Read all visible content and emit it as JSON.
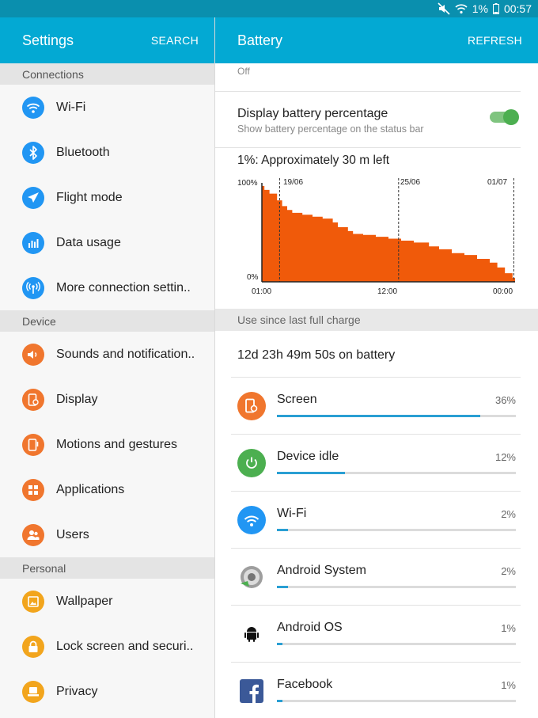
{
  "status_bar": {
    "battery_percent": "1%",
    "time": "00:57",
    "icons": [
      "mute-icon",
      "wifi-icon",
      "battery-icon"
    ]
  },
  "left_panel": {
    "title": "Settings",
    "search_label": "SEARCH",
    "sections": [
      {
        "header": "Connections",
        "items": [
          {
            "label": "Wi-Fi",
            "icon": "wifi-icon",
            "color": "#2196f3"
          },
          {
            "label": "Bluetooth",
            "icon": "bluetooth-icon",
            "color": "#2196f3"
          },
          {
            "label": "Flight mode",
            "icon": "airplane-icon",
            "color": "#2196f3"
          },
          {
            "label": "Data usage",
            "icon": "bar-chart-icon",
            "color": "#2196f3"
          },
          {
            "label": "More connection settin..",
            "icon": "antenna-icon",
            "color": "#2196f3"
          }
        ]
      },
      {
        "header": "Device",
        "items": [
          {
            "label": "Sounds and notification..",
            "icon": "speaker-icon",
            "color": "#f0762e"
          },
          {
            "label": "Display",
            "icon": "display-icon",
            "color": "#f0762e"
          },
          {
            "label": "Motions and gestures",
            "icon": "hand-icon",
            "color": "#f0762e"
          },
          {
            "label": "Applications",
            "icon": "apps-grid-icon",
            "color": "#f0762e"
          },
          {
            "label": "Users",
            "icon": "users-icon",
            "color": "#f0762e"
          }
        ]
      },
      {
        "header": "Personal",
        "items": [
          {
            "label": "Wallpaper",
            "icon": "wallpaper-icon",
            "color": "#f2a51d"
          },
          {
            "label": "Lock screen and securi..",
            "icon": "lock-icon",
            "color": "#f2a51d"
          },
          {
            "label": "Privacy",
            "icon": "privacy-icon",
            "color": "#f2a51d"
          }
        ]
      }
    ]
  },
  "right_panel": {
    "title": "Battery",
    "refresh_label": "REFRESH",
    "cut_row_value": "Off",
    "display_percentage": {
      "title": "Display battery percentage",
      "subtitle": "Show battery percentage on the status bar",
      "enabled": true
    },
    "estimate": "1%: Approximately 30 m left",
    "use_header": "Use since last full charge",
    "on_battery": "12d 23h 49m 50s on battery",
    "usage": [
      {
        "name": "Screen",
        "percent": "36%",
        "fraction": 0.36,
        "icon": "screen-settings-icon",
        "color": "#f0762e"
      },
      {
        "name": "Device idle",
        "percent": "12%",
        "fraction": 0.12,
        "icon": "power-icon",
        "color": "#4caf50"
      },
      {
        "name": "Wi-Fi",
        "percent": "2%",
        "fraction": 0.02,
        "icon": "wifi-icon",
        "color": "#2196f3"
      },
      {
        "name": "Android System",
        "percent": "2%",
        "fraction": 0.02,
        "icon": "android-system-icon",
        "color": "#4caf50"
      },
      {
        "name": "Android OS",
        "percent": "1%",
        "fraction": 0.01,
        "icon": "android-robot-icon",
        "color": "#222222"
      },
      {
        "name": "Facebook",
        "percent": "1%",
        "fraction": 0.01,
        "icon": "facebook-icon",
        "color": "#3b5998"
      }
    ]
  },
  "chart_data": {
    "type": "area",
    "y_top_label": "100%",
    "y_bottom_label": "0%",
    "x_tick_labels": [
      "01:00",
      "12:00",
      "00:00"
    ],
    "date_markers": [
      "19/06",
      "25/06",
      "01/07"
    ],
    "fill_color": "#f05a0a",
    "ylim": [
      0,
      100
    ],
    "x_norm": [
      0,
      0.01,
      0.03,
      0.06,
      0.08,
      0.1,
      0.12,
      0.16,
      0.2,
      0.24,
      0.28,
      0.3,
      0.34,
      0.36,
      0.4,
      0.45,
      0.5,
      0.55,
      0.6,
      0.66,
      0.7,
      0.75,
      0.8,
      0.85,
      0.9,
      0.93,
      0.96,
      0.99,
      1.0
    ],
    "y_values": [
      100,
      96,
      92,
      85,
      79,
      75,
      72,
      70,
      68,
      66,
      62,
      57,
      53,
      50,
      49,
      47,
      45,
      43,
      41,
      37,
      34,
      30,
      28,
      24,
      20,
      15,
      9,
      4,
      2
    ]
  }
}
